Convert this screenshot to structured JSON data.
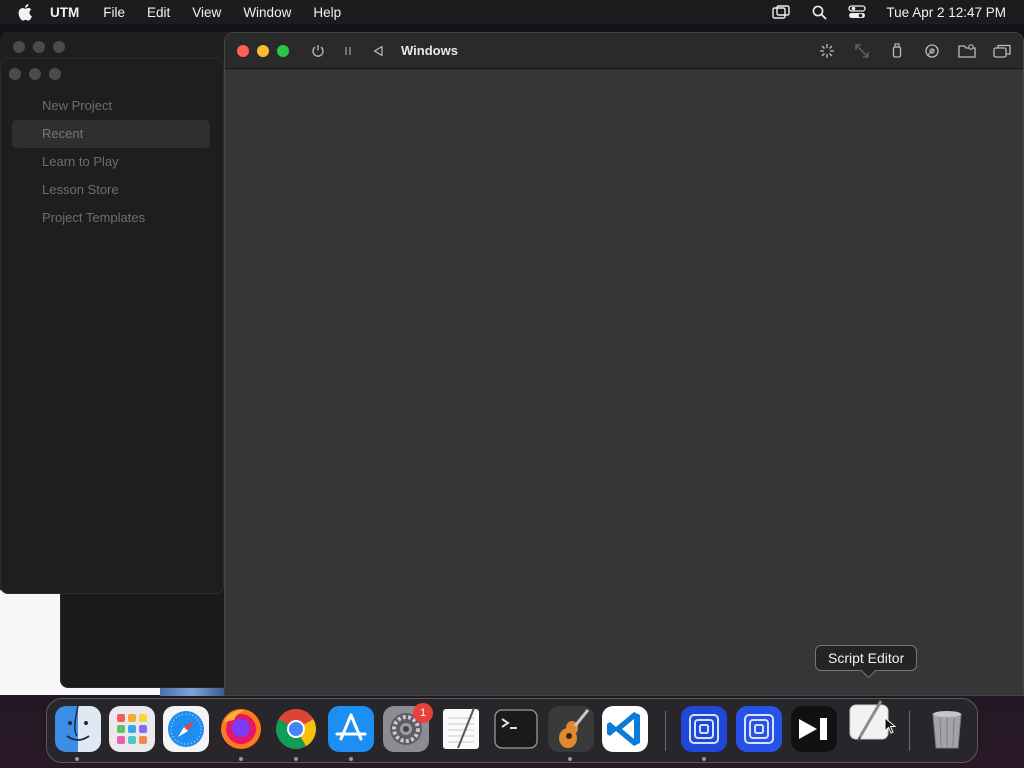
{
  "menubar": {
    "app_name": "UTM",
    "menus": [
      "File",
      "Edit",
      "View",
      "Window",
      "Help"
    ],
    "clock": "Tue Apr 2  12:47 PM",
    "status_icons": [
      "screen-mirroring-icon",
      "search-icon",
      "control-center-icon"
    ]
  },
  "garageband": {
    "items": [
      {
        "label": "New Project",
        "selected": false
      },
      {
        "label": "Recent",
        "selected": true
      },
      {
        "label": "Learn to Play",
        "selected": false
      },
      {
        "label": "Lesson Store",
        "selected": false
      },
      {
        "label": "Project Templates",
        "selected": false
      }
    ]
  },
  "utm": {
    "title": "Windows",
    "left_toolbar": [
      "power-icon",
      "pause-icon",
      "back-icon"
    ],
    "right_toolbar": [
      "capture-input-icon",
      "resize-icon",
      "usb-icon",
      "drive-icon",
      "shared-folder-icon",
      "windows-icon"
    ]
  },
  "tooltip": {
    "text": "Script Editor"
  },
  "dock": {
    "items": [
      "Finder",
      "Launchpad",
      "Safari",
      "Firefox",
      "Chrome",
      "App Store",
      "System Settings",
      "TextEdit",
      "Terminal",
      "GarageBand",
      "Visual Studio Code",
      "UTM",
      "UTM",
      "iMovie",
      "Script Editor",
      "Trash"
    ],
    "settings_badge": "1"
  }
}
